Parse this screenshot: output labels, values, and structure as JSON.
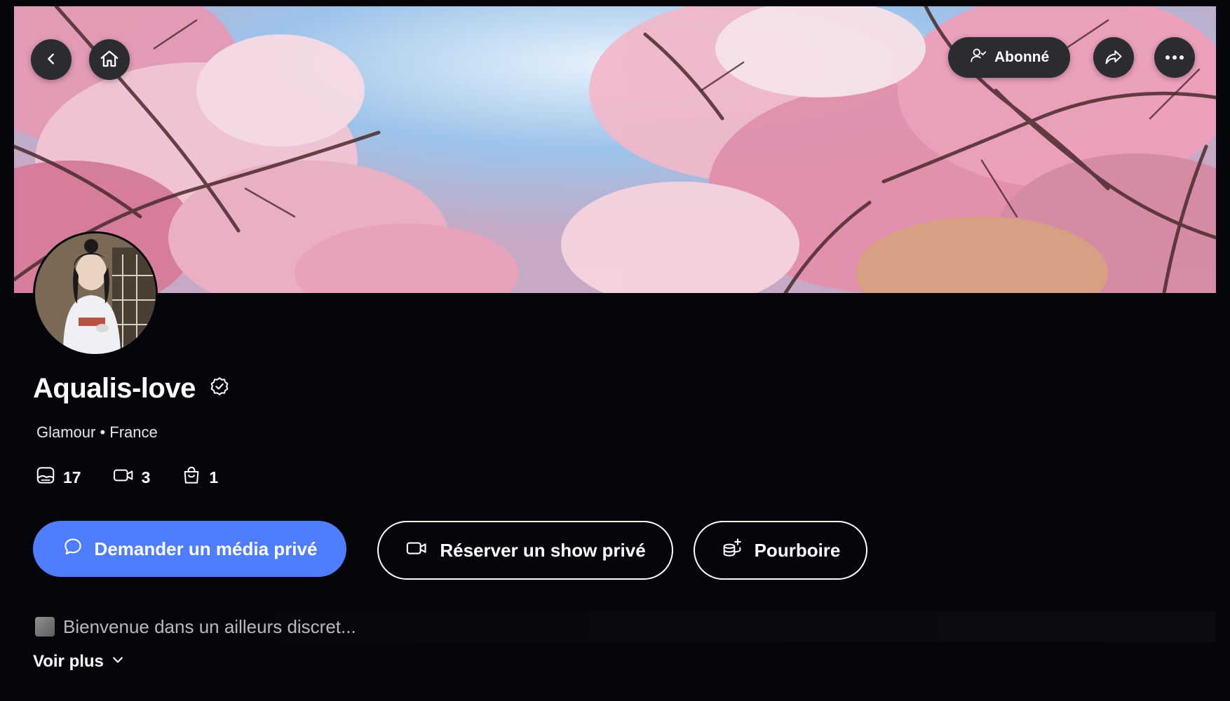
{
  "header": {
    "back_icon": "chevron-left-icon",
    "home_icon": "home-icon",
    "subscribe_label": "Abonné",
    "share_icon": "share-icon",
    "more_icon": "more-dots-icon"
  },
  "profile": {
    "name": "Aqualis-love",
    "verified_icon": "verified-badge-icon",
    "meta": "Glamour • France"
  },
  "stats": [
    {
      "icon": "photo-icon",
      "value": "17"
    },
    {
      "icon": "video-icon",
      "value": "3"
    },
    {
      "icon": "bag-icon",
      "value": "1"
    }
  ],
  "actions": {
    "request_media": "Demander un média privé",
    "book_show": "Réserver un show privé",
    "tip": "Pourboire"
  },
  "bio": {
    "text": "Bienvenue dans un ailleurs discret..."
  },
  "see_more": "Voir plus",
  "colors": {
    "background": "#05060b",
    "primary_button": "#4f7dff",
    "header_button": "#2a2c31"
  }
}
